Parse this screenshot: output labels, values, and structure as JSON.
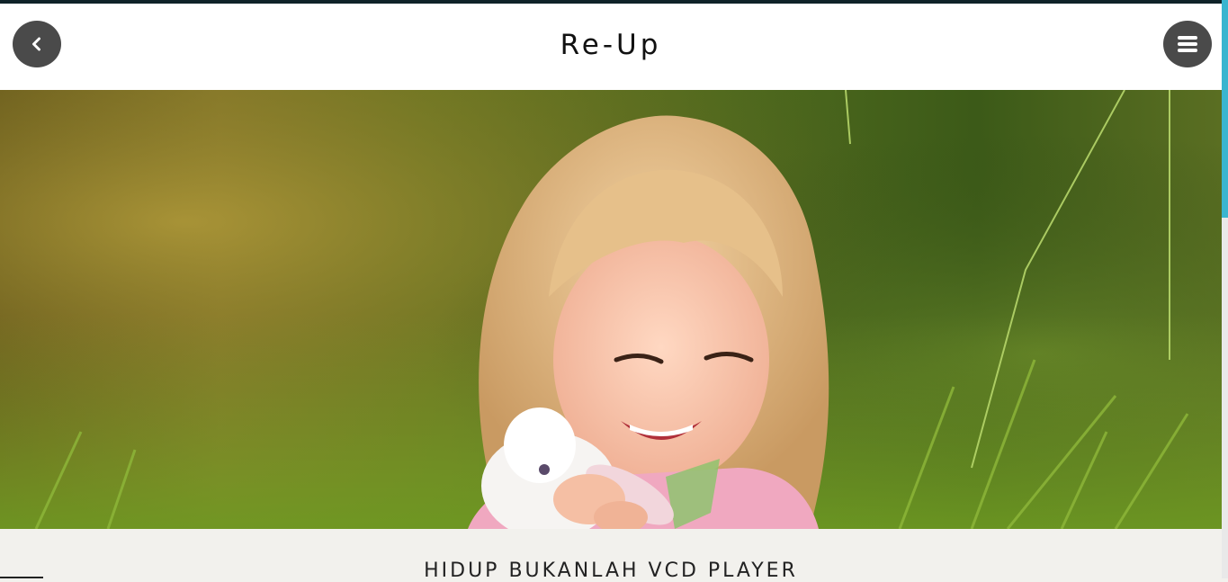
{
  "header": {
    "title": "Re-Up",
    "back_icon": "chevron-left-icon",
    "menu_icon": "hamburger-menu-icon"
  },
  "hero": {
    "image_description_icon": "photo"
  },
  "main": {
    "subtitle": "HIDUP BUKANLAH VCD PLAYER"
  },
  "colors": {
    "button_bg": "#4a4a4a",
    "scrollbar_thumb": "#3ab5cf",
    "page_bg": "#f2f1ed",
    "top_bar": "#0f2228"
  }
}
